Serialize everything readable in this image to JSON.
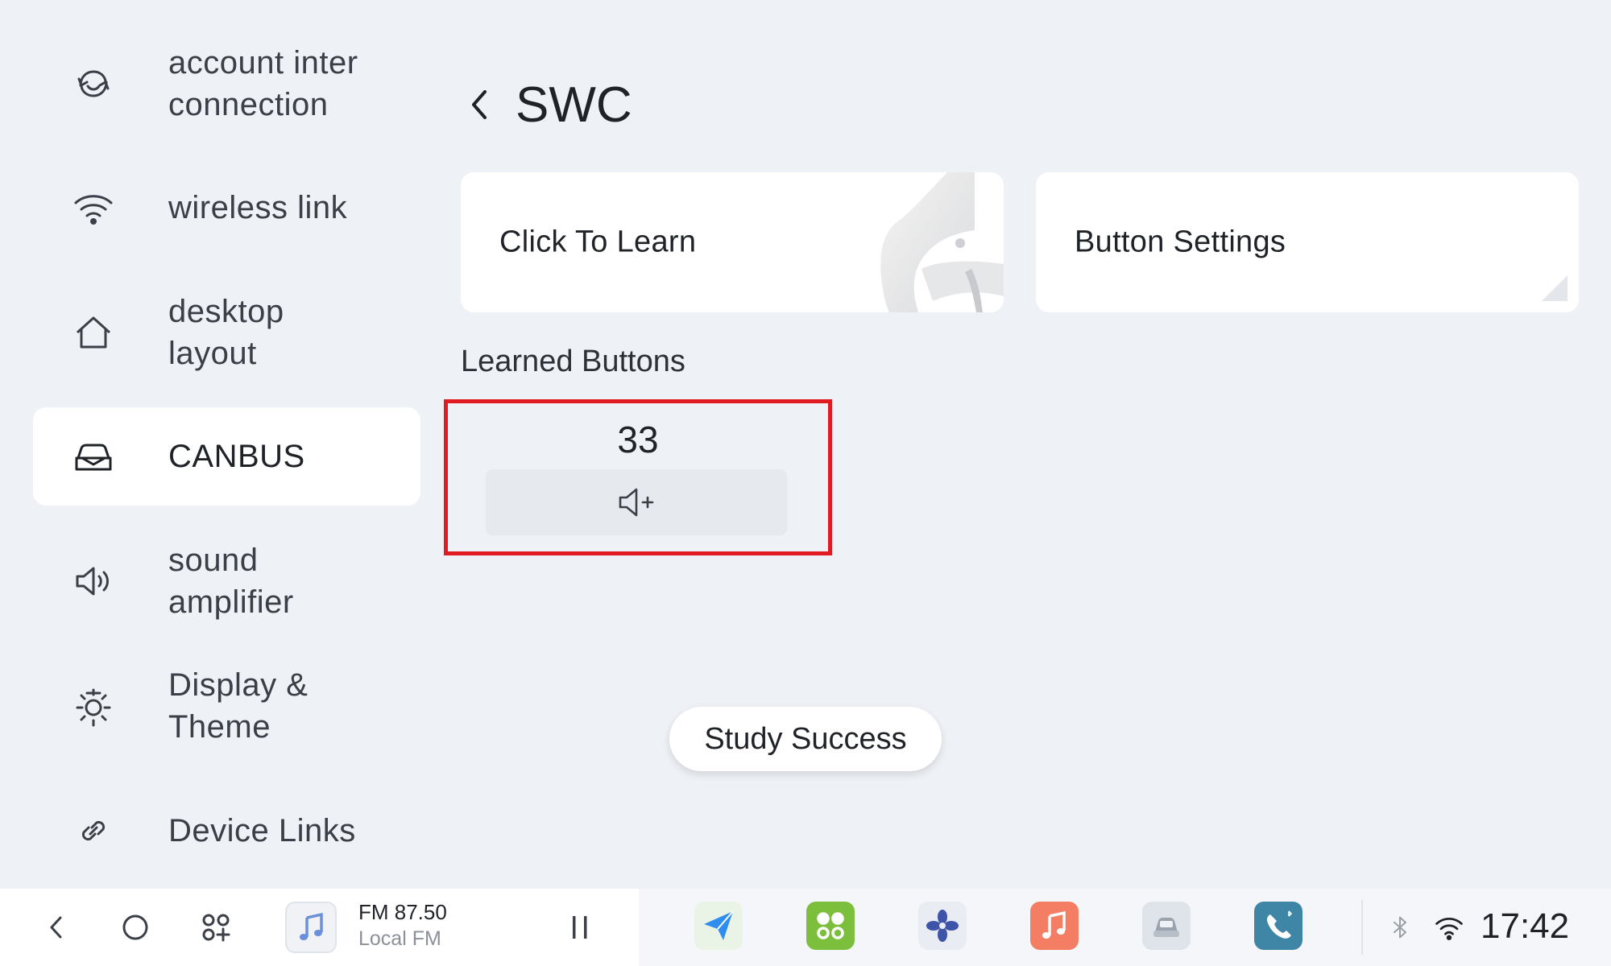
{
  "sidebar": {
    "items": [
      {
        "label": "account inter\nconnection",
        "icon": "account-connect-icon"
      },
      {
        "label": "wireless link",
        "icon": "wifi-icon"
      },
      {
        "label": "desktop\nlayout",
        "icon": "home-icon"
      },
      {
        "label": "CANBUS",
        "icon": "car-icon",
        "active": true
      },
      {
        "label": "sound\namplifier",
        "icon": "speaker-icon"
      },
      {
        "label": "Display &\nTheme",
        "icon": "brightness-icon"
      },
      {
        "label": "Device Links",
        "icon": "link-icon"
      }
    ]
  },
  "header": {
    "title": "SWC"
  },
  "cards": {
    "learn_label": "Click To Learn",
    "settings_label": "Button Settings"
  },
  "learned": {
    "section_label": "Learned Buttons",
    "items": [
      {
        "code": "33",
        "icon": "volume-up-icon"
      }
    ]
  },
  "toast": {
    "text": "Study Success"
  },
  "taskbar": {
    "radio_freq": "FM 87.50",
    "radio_source": "Local FM",
    "apps": [
      "navigation-app-icon",
      "apps-grid-app-icon",
      "fan-app-icon",
      "music-app-icon",
      "car-app-icon",
      "phone-app-icon"
    ],
    "clock": "17:42"
  },
  "colors": {
    "background": "#eef1f5",
    "highlight": "#e11b22",
    "card": "#ffffff"
  }
}
